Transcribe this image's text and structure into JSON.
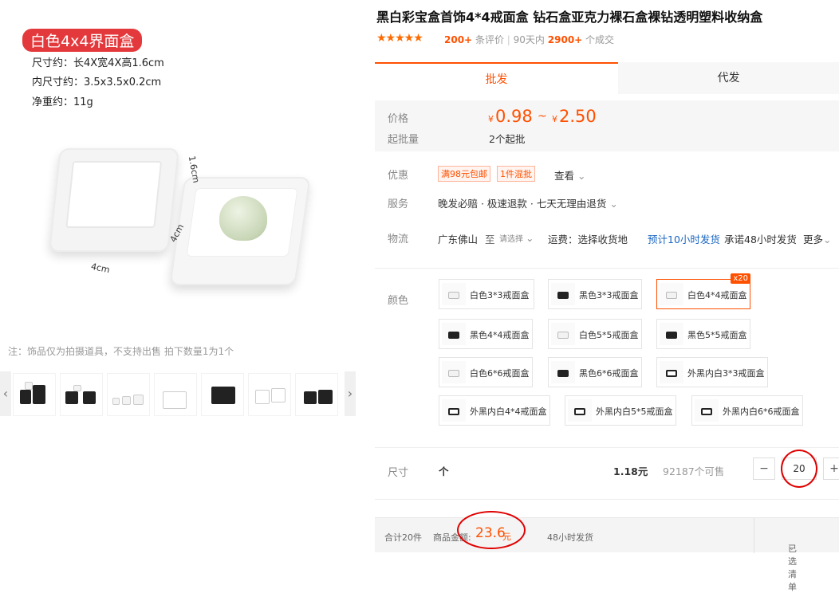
{
  "product": {
    "title": "黑白彩宝盒首饰4*4戒面盒 钻石盒亚克力裸石盒裸钻透明塑料收纳盒",
    "stars": "★★★★★",
    "review_count": "200+",
    "review_label": "条评价",
    "period_label": "90天内",
    "sold_count": "2900+",
    "sold_label": "个成交"
  },
  "image": {
    "tag": "白色4x4界面盒",
    "specs": [
      "尺寸约：长4X宽4X高1.6cm",
      "内尺寸约：3.5x3.5x0.2cm",
      "净重约：11g"
    ],
    "dim_height": "1.6cm",
    "dim_width": "4cm",
    "dim_depth": "4cm",
    "note": "注：饰品仅为拍摄道具，不支持出售 拍下数量1为1个",
    "prev_icon": "chevron-left-icon",
    "next_icon": "chevron-right-icon",
    "prev_glyph": "‹",
    "next_glyph": "›"
  },
  "tabs": {
    "wholesale": "批发",
    "dropship": "代发"
  },
  "price": {
    "label": "价格",
    "currency": "¥",
    "low": "0.98",
    "tilde": "~",
    "high": "2.50",
    "moq_label": "起批量",
    "moq": "2个起批",
    "accent": "#ff5000"
  },
  "promo": {
    "label": "优惠",
    "badge1": "满98元包邮",
    "badge2": "1件混批",
    "view": "查看",
    "chevron": "⌄"
  },
  "service": {
    "label": "服务",
    "value": "晚发必赔 · 极速退款 · 七天无理由退货",
    "chevron": "⌄"
  },
  "logistics": {
    "label": "物流",
    "from": "广东佛山",
    "to": "至",
    "to_select": "请选择",
    "chevron": "⌄",
    "fee": "运费：选择收货地",
    "eta": "预计10小时发货",
    "promise": "承诺48小时发货",
    "more": "更多"
  },
  "color": {
    "label": "颜色",
    "selected_count": "x20",
    "options": [
      {
        "name": "白色3*3戒面盒",
        "tone": "white"
      },
      {
        "name": "黑色3*3戒面盒",
        "tone": "black"
      },
      {
        "name": "白色4*4戒面盒",
        "tone": "white",
        "selected": true
      },
      {
        "name": "黑色4*4戒面盒",
        "tone": "black"
      },
      {
        "name": "白色5*5戒面盒",
        "tone": "white"
      },
      {
        "name": "黑色5*5戒面盒",
        "tone": "black"
      },
      {
        "name": "白色6*6戒面盒",
        "tone": "white"
      },
      {
        "name": "黑色6*6戒面盒",
        "tone": "black"
      },
      {
        "name": "外黑内白3*3戒面盒",
        "tone": "mixed"
      },
      {
        "name": "外黑内白4*4戒面盒",
        "tone": "mixed"
      },
      {
        "name": "外黑内白5*5戒面盒",
        "tone": "mixed"
      },
      {
        "name": "外黑内白6*6戒面盒",
        "tone": "mixed"
      }
    ]
  },
  "size": {
    "label": "尺寸",
    "unit": "个",
    "unit_price": "1.18元",
    "stock": "92187个可售",
    "minus": "−",
    "quantity": "20",
    "plus": "+"
  },
  "footer": {
    "total_count": "合计20件",
    "amount_label": "商品金额:",
    "amount": "23.6",
    "amount_unit": "元",
    "ship": "48小时发货",
    "cart": "已选清单",
    "cart_chevron": "⌄"
  }
}
